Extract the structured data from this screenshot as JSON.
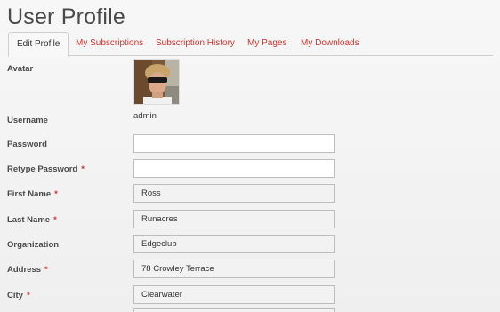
{
  "page": {
    "title": "User Profile"
  },
  "tabs": [
    {
      "label": "Edit Profile",
      "active": true
    },
    {
      "label": "My Subscriptions",
      "active": false
    },
    {
      "label": "Subscription History",
      "active": false
    },
    {
      "label": "My Pages",
      "active": false
    },
    {
      "label": "My Downloads",
      "active": false
    }
  ],
  "form": {
    "avatar": {
      "label": "Avatar"
    },
    "username": {
      "label": "Username",
      "value": "admin"
    },
    "password": {
      "label": "Password",
      "value": ""
    },
    "retype_password": {
      "label": "Retype Password",
      "required_mark": "*",
      "value": ""
    },
    "first_name": {
      "label": "First Name",
      "required_mark": "*",
      "value": "Ross"
    },
    "last_name": {
      "label": "Last Name",
      "required_mark": "*",
      "value": "Runacres"
    },
    "organization": {
      "label": "Organization",
      "value": "Edgeclub"
    },
    "address": {
      "label": "Address",
      "required_mark": "*",
      "value": "78 Crowley Terrace"
    },
    "city": {
      "label": "City",
      "required_mark": "*",
      "value": "Clearwater"
    }
  },
  "colors": {
    "accent": "#d0342c",
    "label_text": "#4a4a4a",
    "input_border": "#bdbdbd"
  }
}
